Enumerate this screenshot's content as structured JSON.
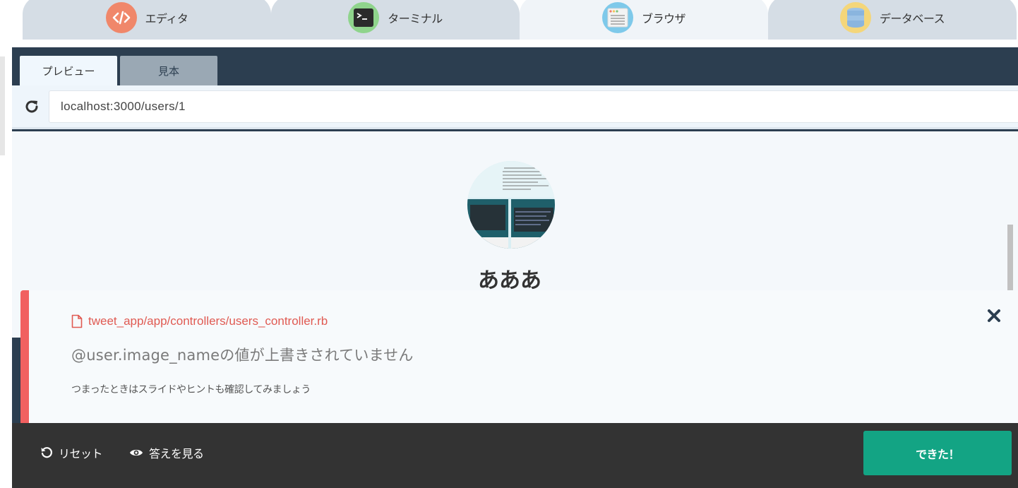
{
  "env_tabs": [
    {
      "label": "エディタ",
      "icon": "code-icon",
      "color": "#f0876a",
      "active": false
    },
    {
      "label": "ターミナル",
      "icon": "terminal-icon",
      "color": "#8fd48c",
      "active": false
    },
    {
      "label": "ブラウザ",
      "icon": "browser-icon",
      "color": "#7ec9ea",
      "active": true
    },
    {
      "label": "データベース",
      "icon": "database-icon",
      "color": "#f4d67a",
      "active": false
    }
  ],
  "preview_tabs": {
    "preview_label": "プレビュー",
    "sample_label": "見本"
  },
  "urlbar": {
    "url": "localhost:3000/users/1"
  },
  "page": {
    "username": "あああ"
  },
  "error": {
    "file": "tweet_app/app/controllers/users_controller.rb",
    "title": "@user.image_nameの値が上書きされていません",
    "hint": "つまったときはスライドやヒントも確認してみましょう",
    "accent_color": "#f16060"
  },
  "bottom": {
    "reset_label": "リセット",
    "answer_label": "答えを見る",
    "done_label": "できた！",
    "done_color": "#13a484"
  }
}
